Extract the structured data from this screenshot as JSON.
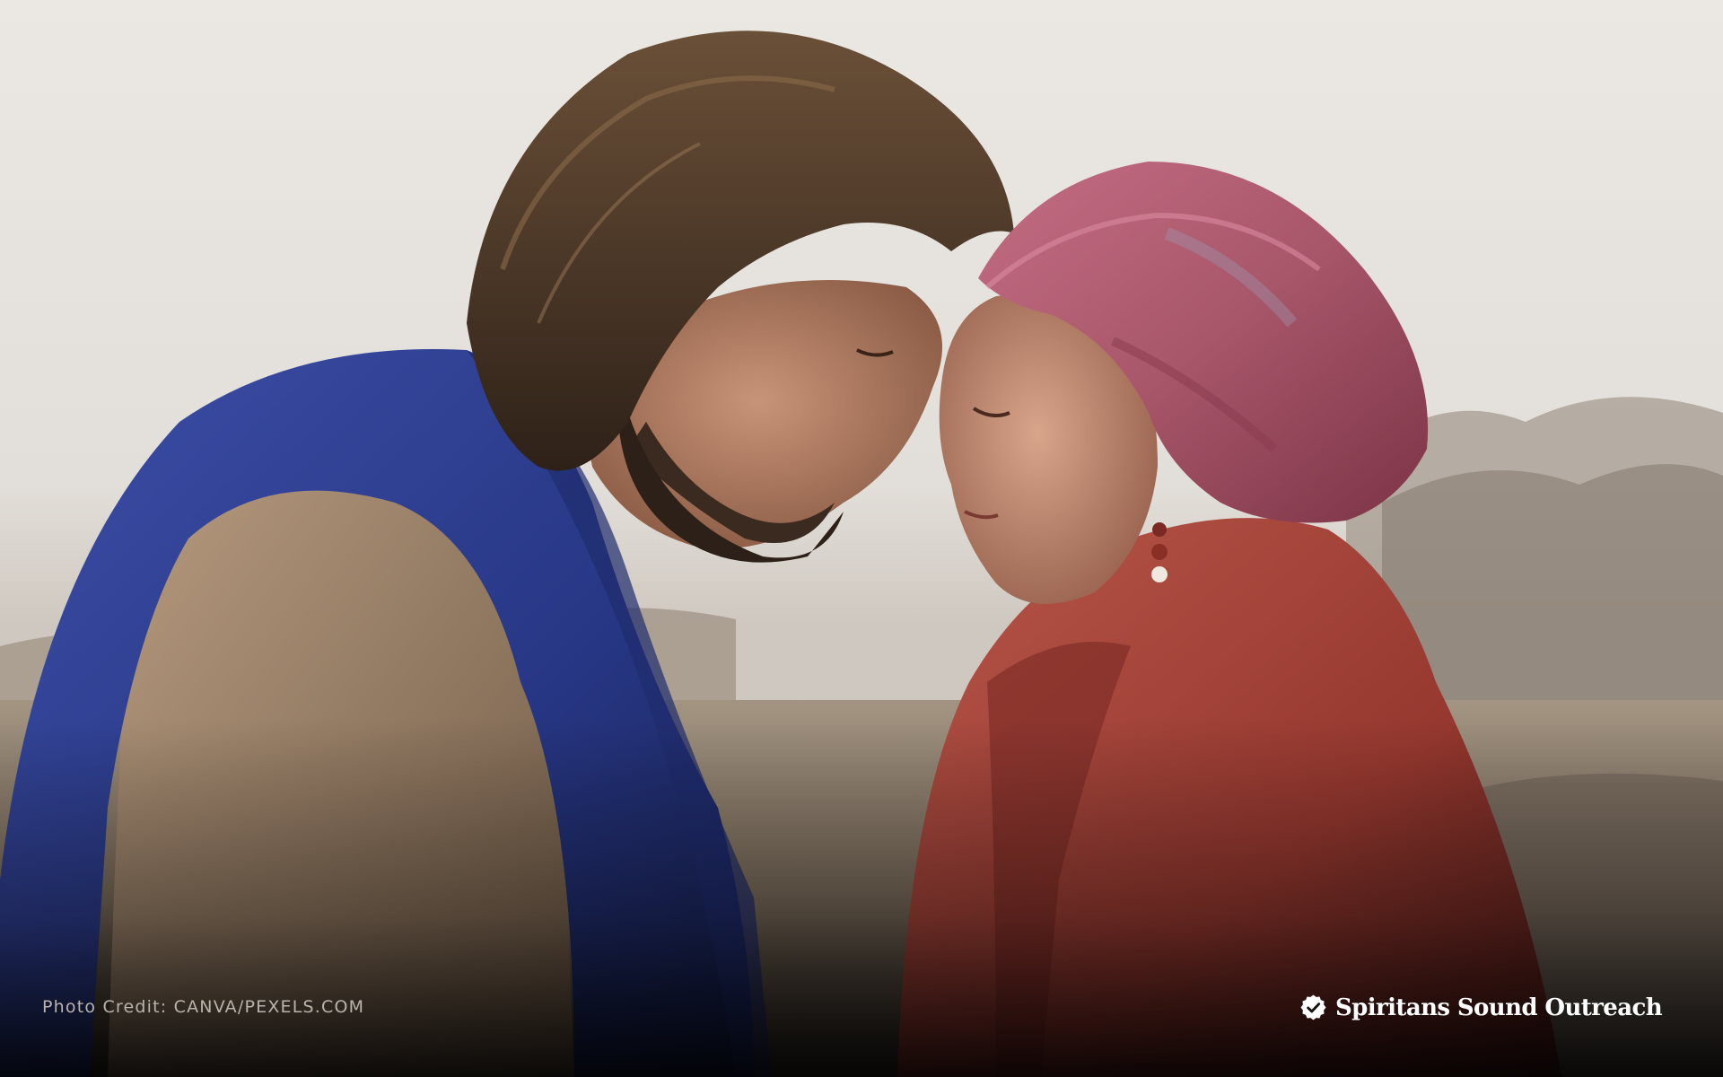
{
  "photo": {
    "description_icon": "photo-scene",
    "credit_text": "Photo Credit: CANVA/PEXELS.COM"
  },
  "brand": {
    "icon": "check-badge-icon",
    "name": "Spiritans Sound Outreach"
  },
  "colors": {
    "sky": "#e6e2dd",
    "blue_robe": "#2c3b8c",
    "tan_tunic": "#a88c6e",
    "red_shawl": "#a2413a",
    "pink_headscarf": "#b75f78",
    "text_white": "#ffffff",
    "text_muted": "#b9b3ad"
  }
}
